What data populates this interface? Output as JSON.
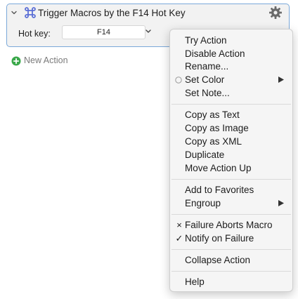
{
  "action": {
    "title": "Trigger Macros by the F14 Hot Key",
    "hotkey_label": "Hot key:",
    "hotkey_value": "F14"
  },
  "new_action_label": "New Action",
  "menu": {
    "try_action": "Try Action",
    "disable_action": "Disable Action",
    "rename": "Rename...",
    "set_color": "Set Color",
    "set_note": "Set Note...",
    "copy_as_text": "Copy as Text",
    "copy_as_image": "Copy as Image",
    "copy_as_xml": "Copy as XML",
    "duplicate": "Duplicate",
    "move_action_up": "Move Action Up",
    "add_to_favorites": "Add to Favorites",
    "engroup": "Engroup",
    "failure_aborts_macro": "Failure Aborts Macro",
    "failure_aborts_mark": "×",
    "notify_on_failure": "Notify on Failure",
    "notify_mark": "✓",
    "collapse_action": "Collapse Action",
    "help": "Help"
  },
  "colors": {
    "panel_border": "#7aa8d9",
    "command_icon": "#5b6fd6",
    "new_action_plus": "#3aa84a"
  }
}
